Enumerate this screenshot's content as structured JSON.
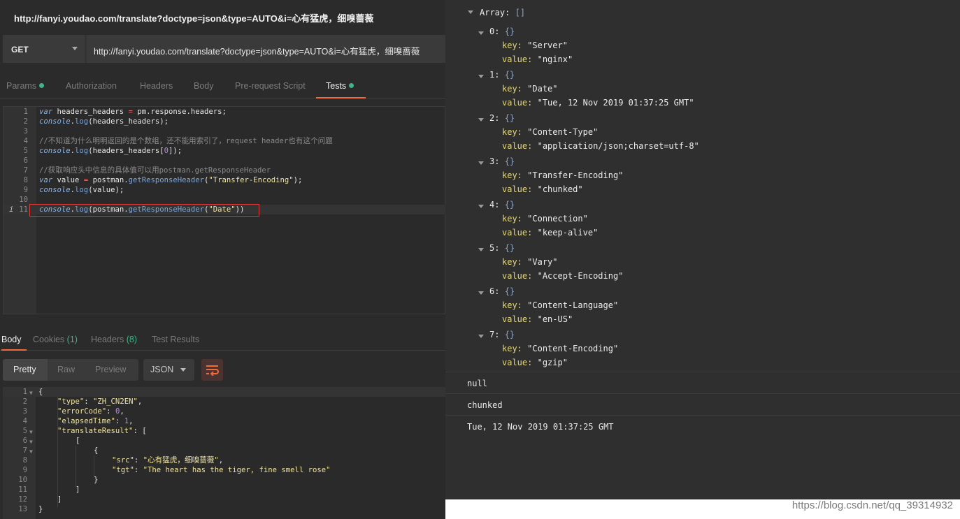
{
  "request": {
    "title": "http://fanyi.youdao.com/translate?doctype=json&type=AUTO&i=心有猛虎，细嗅蔷薇",
    "method": "GET",
    "url": "http://fanyi.youdao.com/translate?doctype=json&type=AUTO&i=心有猛虎，细嗅蔷薇"
  },
  "request_tabs": [
    "Params",
    "Authorization",
    "Headers",
    "Body",
    "Pre-request Script",
    "Tests"
  ],
  "active_request_tab": "Tests",
  "tests_code": {
    "line_numbers": [
      "1",
      "2",
      "3",
      "4",
      "5",
      "6",
      "7",
      "8",
      "9",
      "10",
      "11"
    ],
    "info_marker": "i",
    "l1": {
      "kw": "var",
      "a": " headers_headers ",
      "op": "=",
      "b": " pm.response.headers;"
    },
    "l2": {
      "obj": "console",
      "dot": ".",
      "fn": "log",
      "rest": "(headers_headers);"
    },
    "l4": "//不知道为什么明明返回的是个数组，还不能用索引了，request header也有这个问题",
    "l5": {
      "obj": "console",
      "dot": ".",
      "fn": "log",
      "a": "(headers_headers[",
      "num": "0",
      "b": "]);"
    },
    "l7": "//获取响应头中信息的具体值可以用postman.getResponseHeader",
    "l8": {
      "kw": "var",
      "a": " value ",
      "op": "=",
      "b": " postman.",
      "fn": "getResponseHeader",
      "c": "(",
      "str": "\"Transfer-Encoding\"",
      "d": ");"
    },
    "l9": {
      "obj": "console",
      "dot": ".",
      "fn": "log",
      "rest": "(value);"
    },
    "l11": {
      "obj": "console",
      "dot": ".",
      "fn1": "log",
      "a": "(postman.",
      "fn2": "getResponseHeader",
      "b": "(",
      "str": "\"Date\"",
      "c": "))"
    }
  },
  "response_tabs": {
    "body": "Body",
    "cookies": "Cookies",
    "cookies_count": "(1)",
    "headers": "Headers",
    "headers_count": "(8)",
    "test_results": "Test Results"
  },
  "view_modes": [
    "Pretty",
    "Raw",
    "Preview"
  ],
  "format": "JSON",
  "response_json": {
    "line_numbers": [
      "1",
      "2",
      "3",
      "4",
      "5",
      "6",
      "7",
      "8",
      "9",
      "10",
      "11",
      "12",
      "13"
    ],
    "l1": "{",
    "l2k": "\"type\"",
    "l2v": "\"ZH_CN2EN\"",
    "l3k": "\"errorCode\"",
    "l3v": "0",
    "l4k": "\"elapsedTime\"",
    "l4v": "1",
    "l5k": "\"translateResult\"",
    "l5v": "[",
    "l6": "[",
    "l7": "{",
    "l8k": "\"src\"",
    "l8v": "\"心有猛虎，细嗅蔷薇\"",
    "l9k": "\"tgt\"",
    "l9v": "\"The heart has the tiger, fine smell rose\"",
    "l10": "}",
    "l11": "]",
    "l12": "]",
    "l13": "}"
  },
  "console": {
    "array_label": "Array:",
    "array_brace": "[]",
    "obj_brace": "{}",
    "key_label": "key:",
    "value_label": "value:",
    "headers": [
      {
        "index": "0:",
        "key": "\"Server\"",
        "value": "\"nginx\""
      },
      {
        "index": "1:",
        "key": "\"Date\"",
        "value": "\"Tue, 12 Nov 2019 01:37:25 GMT\""
      },
      {
        "index": "2:",
        "key": "\"Content-Type\"",
        "value": "\"application/json;charset=utf-8\""
      },
      {
        "index": "3:",
        "key": "\"Transfer-Encoding\"",
        "value": "\"chunked\""
      },
      {
        "index": "4:",
        "key": "\"Connection\"",
        "value": "\"keep-alive\""
      },
      {
        "index": "5:",
        "key": "\"Vary\"",
        "value": "\"Accept-Encoding\""
      },
      {
        "index": "6:",
        "key": "\"Content-Language\"",
        "value": "\"en-US\""
      },
      {
        "index": "7:",
        "key": "\"Content-Encoding\"",
        "value": "\"gzip\""
      }
    ],
    "logs": [
      "null",
      "chunked",
      "Tue, 12 Nov 2019 01:37:25 GMT"
    ]
  },
  "watermark": "https://blog.csdn.net/qq_39314932",
  "colors": {
    "accent": "#f26b3a",
    "status_green": "#3fb488",
    "highlight_box": "#e03a3a"
  }
}
